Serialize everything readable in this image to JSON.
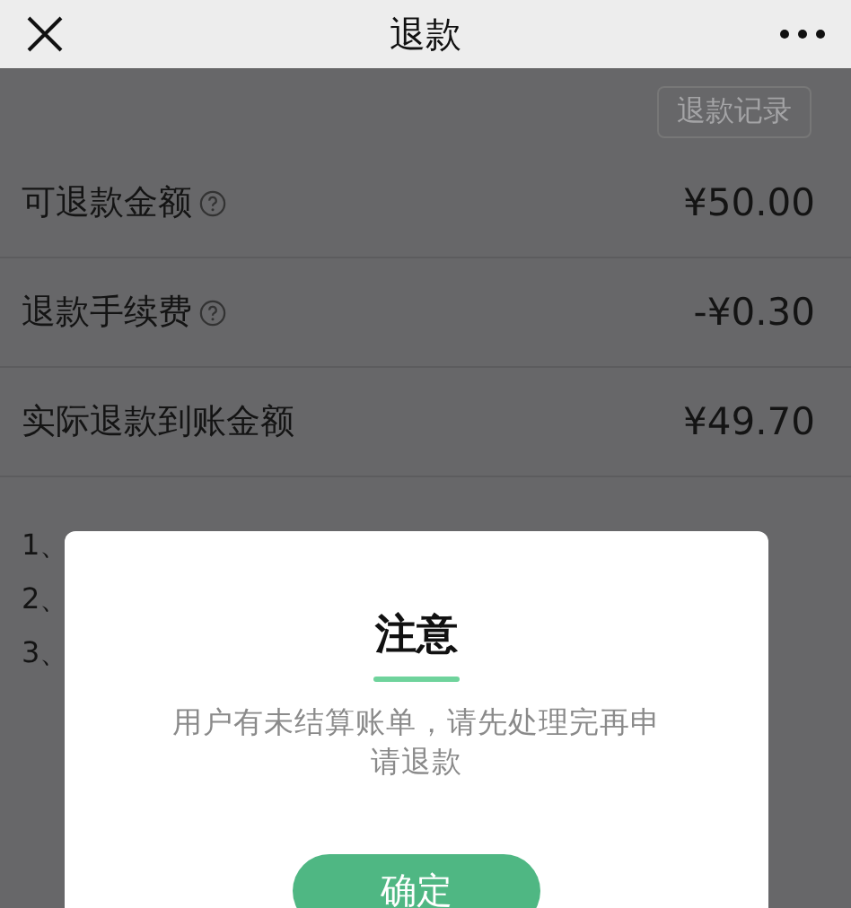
{
  "header": {
    "title": "退款"
  },
  "record_button": "退款记录",
  "amounts": [
    {
      "label": "可退款金额",
      "help": true,
      "value": "¥50.00"
    },
    {
      "label": "退款手续费",
      "help": true,
      "value": "-¥0.30"
    },
    {
      "label": "实际退款到账金额",
      "help": false,
      "value": "¥49.70"
    }
  ],
  "notes": [
    "1、",
    "2、",
    "3、"
  ],
  "dialog": {
    "title": "注意",
    "message": "用户有未结算账单，请先处理完再申请退款",
    "button": "确定"
  }
}
